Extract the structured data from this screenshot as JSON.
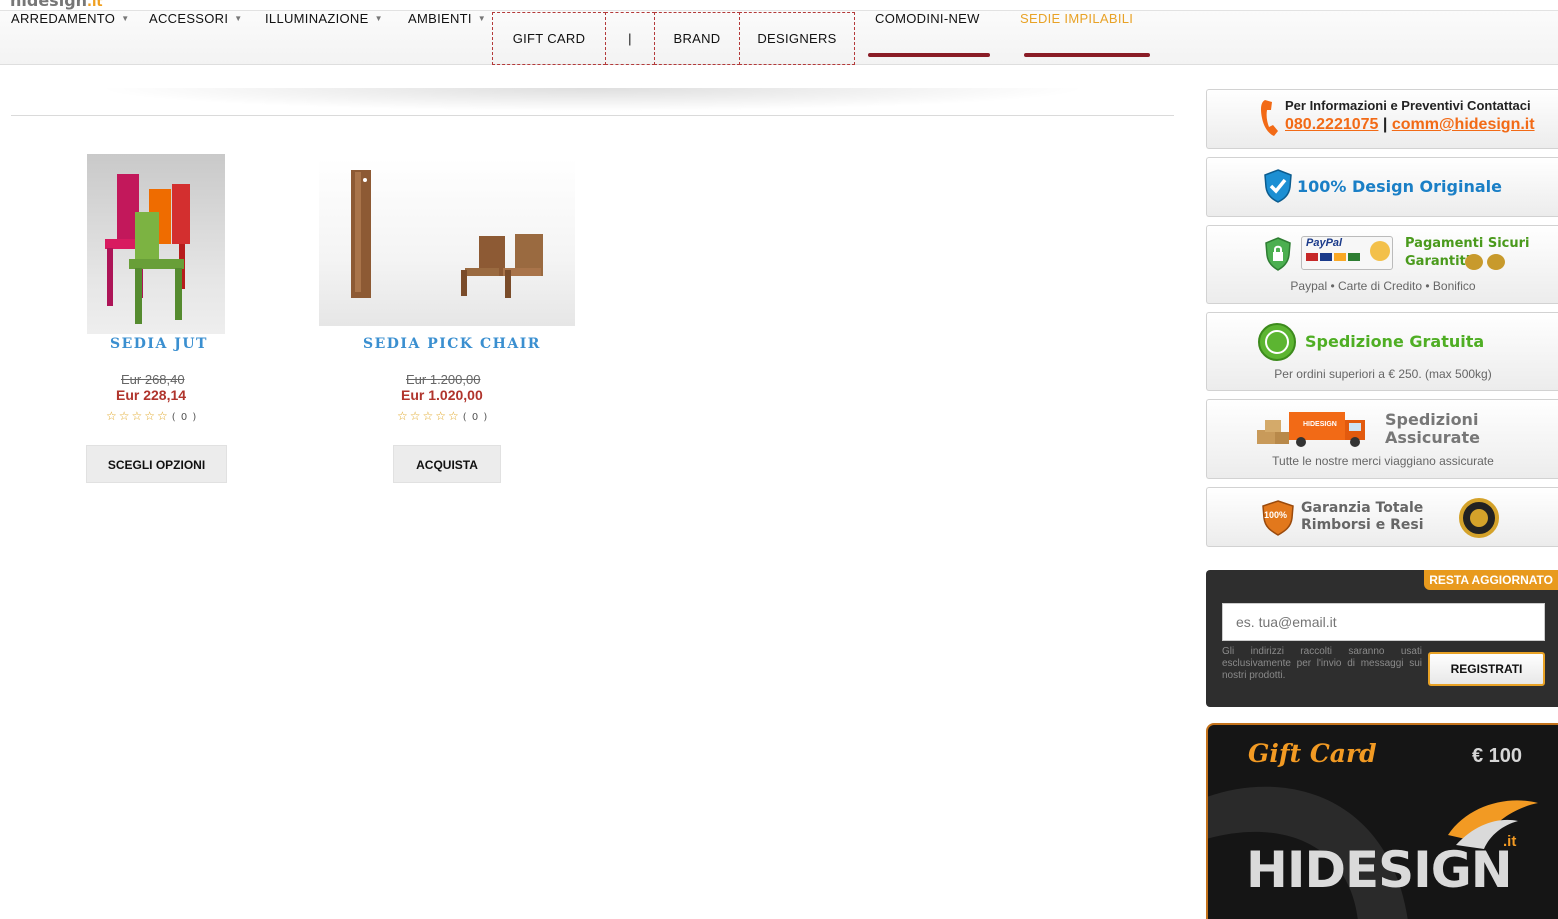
{
  "logo": {
    "text": "hidesign",
    "suffix": ".it"
  },
  "nav": {
    "items": [
      {
        "label": "ARREDAMENTO",
        "caret": true
      },
      {
        "label": "ACCESSORI",
        "caret": true
      },
      {
        "label": "ILLUMINAZIONE",
        "caret": true
      },
      {
        "label": "AMBIENTI",
        "caret": true
      },
      {
        "label": "GIFT CARD"
      },
      {
        "label": "|"
      },
      {
        "label": "BRAND"
      },
      {
        "label": "DESIGNERS"
      },
      {
        "label": "COMODINI-NEW"
      },
      {
        "label": "SEDIE IMPILABILI"
      }
    ]
  },
  "products": [
    {
      "name": "SEDIA JUT",
      "old_price": "Eur 268,40",
      "new_price": "Eur 228,14",
      "stars": "☆☆☆☆☆",
      "rating_count": "( 0 )",
      "button": "SCEGLI OPZIONI"
    },
    {
      "name": "SEDIA PICK CHAIR",
      "old_price": "Eur 1.200,00",
      "new_price": "Eur 1.020,00",
      "stars": "☆☆☆☆☆",
      "rating_count": "( 0 )",
      "button": "ACQUISTA"
    }
  ],
  "sidebar": {
    "contact": {
      "line1": "Per Informazioni e Preventivi Contattaci",
      "phone": "080.2221075",
      "sep": "|",
      "email": "comm@hidesign.it"
    },
    "design": {
      "title": "100% Design Originale"
    },
    "payments": {
      "paypal": "PayPal",
      "title1": "Pagamenti Sicuri",
      "title2": "Garantiti.",
      "sub": "Paypal • Carte di Credito • Bonifico"
    },
    "shipping": {
      "title": "Spedizione Gratuita",
      "sub": "Per ordini superiori a € 250. (max 500kg)"
    },
    "insured": {
      "truck_label": "HIDESIGN",
      "title1": "Spedizioni",
      "title2": "Assicurate",
      "sub": "Tutte le nostre merci viaggiano assicurate"
    },
    "guarantee": {
      "badge": "100%",
      "title1": "Garanzia Totale",
      "title2": "Rimborsi e Resi"
    }
  },
  "newsletter": {
    "tag": "RESTA AGGIORNATO",
    "placeholder": "es. tua@email.it",
    "note": "Gli indirizzi raccolti saranno usati esclusivamente per l'invio di messaggi sui nostri prodotti.",
    "button": "REGISTRATI"
  },
  "giftcard": {
    "title": "Gift Card",
    "amount": "€ 100",
    "brand": "HIDESIGN",
    "brand_suffix": ".it"
  },
  "colors": {
    "accent_orange": "#e8a226",
    "link_blue": "#3a8fd0",
    "price_red": "#b0342c",
    "nav_underline": "#8a1c26"
  }
}
